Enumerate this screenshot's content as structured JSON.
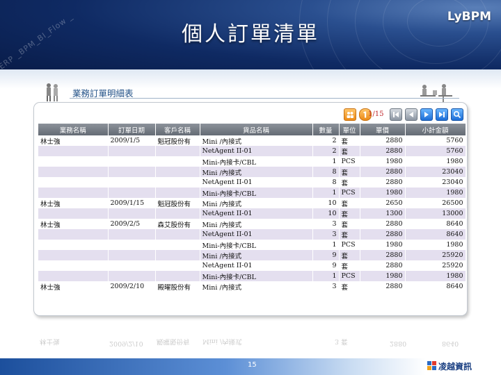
{
  "slide": {
    "title": "個人訂單清單",
    "brand": "LyBPM",
    "watermark": "ERP _BPM_BI_Flow _",
    "page_number": "15",
    "company_logo": "凌越資訊"
  },
  "panel": {
    "title": "業務訂單明細表",
    "pager": "1/15"
  },
  "toolbar_icons": [
    "group-icon",
    "first-page-icon",
    "prev-page-icon",
    "next-page-icon",
    "last-page-icon",
    "search-icon"
  ],
  "table": {
    "headers": [
      "業務名稱",
      "訂單日期",
      "客戶名稱",
      "貨品名稱",
      "數量",
      "單位",
      "單價",
      "小計金額"
    ],
    "rows": [
      [
        "林士強",
        "2009/1/5",
        "魁冠股份有",
        "Mini /內接式",
        "2",
        "套",
        "2880",
        "5760"
      ],
      [
        "",
        "",
        "",
        "NetAgent II-01",
        "2",
        "套",
        "2880",
        "5760"
      ],
      [
        "",
        "",
        "",
        "Mini-內接卡/CBL",
        "1",
        "PCS",
        "1980",
        "1980"
      ],
      [
        "",
        "",
        "",
        "Mini /內接式",
        "8",
        "套",
        "2880",
        "23040"
      ],
      [
        "",
        "",
        "",
        "NetAgent II-01",
        "8",
        "套",
        "2880",
        "23040"
      ],
      [
        "",
        "",
        "",
        "Mini-內接卡/CBL",
        "1",
        "PCS",
        "1980",
        "1980"
      ],
      [
        "林士強",
        "2009/1/15",
        "魁冠股份有",
        "Mini /內接式",
        "10",
        "套",
        "2650",
        "26500"
      ],
      [
        "",
        "",
        "",
        "NetAgent II-01",
        "10",
        "套",
        "1300",
        "13000"
      ],
      [
        "林士強",
        "2009/2/5",
        "森艾股份有",
        "Mini /內接式",
        "3",
        "套",
        "2880",
        "8640"
      ],
      [
        "",
        "",
        "",
        "NetAgent II-01",
        "3",
        "套",
        "2880",
        "8640"
      ],
      [
        "",
        "",
        "",
        "Mini-內接卡/CBL",
        "1",
        "PCS",
        "1980",
        "1980"
      ],
      [
        "",
        "",
        "",
        "Mini /內接式",
        "9",
        "套",
        "2880",
        "25920"
      ],
      [
        "",
        "",
        "",
        "NetAgent II-01",
        "9",
        "套",
        "2880",
        "25920"
      ],
      [
        "",
        "",
        "",
        "Mini-內接卡/CBL",
        "1",
        "PCS",
        "1980",
        "1980"
      ],
      [
        "林士強",
        "2009/2/10",
        "殿曜股份有",
        "Mini /內接式",
        "3",
        "套",
        "2880",
        "8640"
      ]
    ]
  }
}
